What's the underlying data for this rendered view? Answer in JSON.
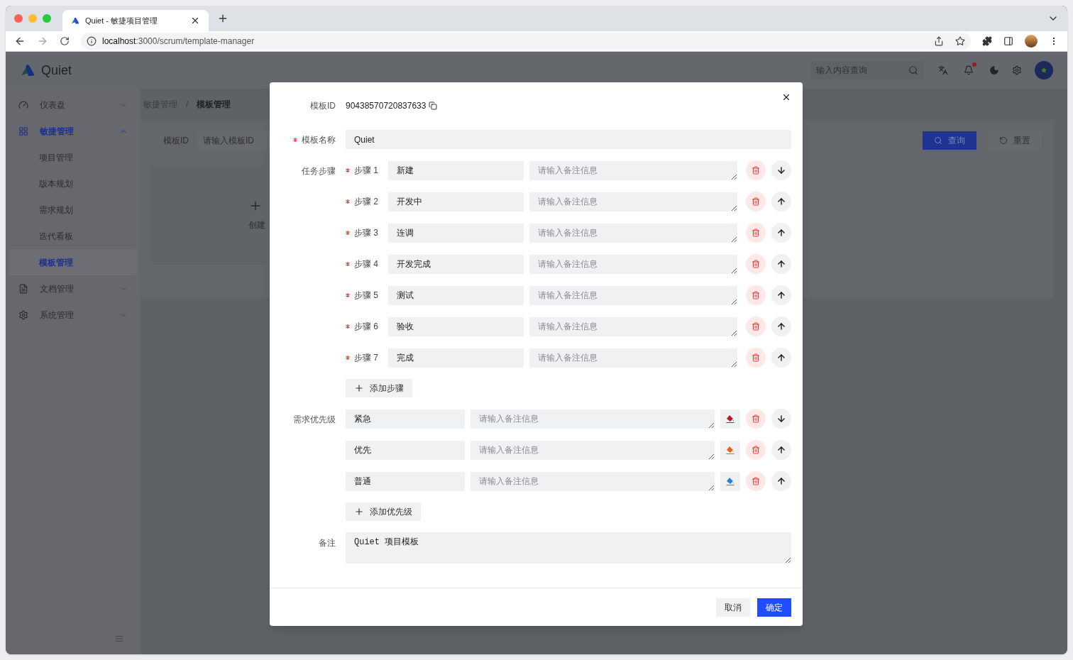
{
  "browser": {
    "tab_title": "Quiet - 敏捷项目管理",
    "url": "**localhost**:3000/scrum/template-manager"
  },
  "app": {
    "brand": "Quiet",
    "search": {
      "placeholder": "输入内容查询"
    },
    "notifications_unread": true
  },
  "sidebar": {
    "items": [
      {
        "label": "仪表盘",
        "expanded": false,
        "selected": false
      },
      {
        "label": "敏捷管理",
        "expanded": true,
        "selected": true,
        "children": [
          {
            "label": "项目管理",
            "selected": false
          },
          {
            "label": "版本规划",
            "selected": false
          },
          {
            "label": "需求规划",
            "selected": false
          },
          {
            "label": "迭代看板",
            "selected": false
          },
          {
            "label": "模板管理",
            "selected": true
          }
        ]
      },
      {
        "label": "文档管理",
        "expanded": false,
        "selected": false
      },
      {
        "label": "系统管理",
        "expanded": false,
        "selected": false
      }
    ]
  },
  "breadcrumb": {
    "items": [
      "敏捷管理",
      "模板管理"
    ],
    "separator": "/"
  },
  "filter": {
    "label": "模板ID",
    "placeholder": "请输入模板ID",
    "buttons": [
      "查询",
      "重置"
    ]
  },
  "create_card": {
    "label": "创建"
  },
  "dialog": {
    "id_label": "模板ID",
    "id_value": "90438570720837633",
    "name_label": "模板名称",
    "name_value": "Quiet",
    "name_required": true,
    "steps_label": "任务步骤",
    "steps": [
      {
        "label": "步骤 1",
        "value": "新建",
        "placeholder": "请输入备注信息",
        "required": true,
        "kind": "down"
      },
      {
        "label": "步骤 2",
        "value": "开发中",
        "placeholder": "请输入备注信息",
        "required": true,
        "kind": "up"
      },
      {
        "label": "步骤 3",
        "value": "连调",
        "placeholder": "请输入备注信息",
        "required": true,
        "kind": "up"
      },
      {
        "label": "步骤 4",
        "value": "开发完成",
        "placeholder": "请输入备注信息",
        "required": true,
        "kind": "up"
      },
      {
        "label": "步骤 5",
        "value": "测试",
        "placeholder": "请输入备注信息",
        "required": true,
        "kind": "up"
      },
      {
        "label": "步骤 6",
        "value": "验收",
        "placeholder": "请输入备注信息",
        "required": true,
        "kind": "up"
      },
      {
        "label": "步骤 7",
        "value": "完成",
        "placeholder": "请输入备注信息",
        "required": true,
        "kind": "up"
      }
    ],
    "add_step": "添加步骤",
    "priority_label": "需求优先级",
    "priorities": [
      {
        "value": "紧急",
        "placeholder": "请输入备注信息",
        "color": "#c0162b",
        "kind": "down"
      },
      {
        "value": "优先",
        "placeholder": "请输入备注信息",
        "color": "#e0661a",
        "kind": "up"
      },
      {
        "value": "普通",
        "placeholder": "请输入备注信息",
        "color": "#2f7de1",
        "kind": "up"
      }
    ],
    "add_priority": "添加优先级",
    "remark_label": "备注",
    "remark_value": "Quiet 项目模板",
    "cancel": "取消",
    "ok": "确定"
  }
}
